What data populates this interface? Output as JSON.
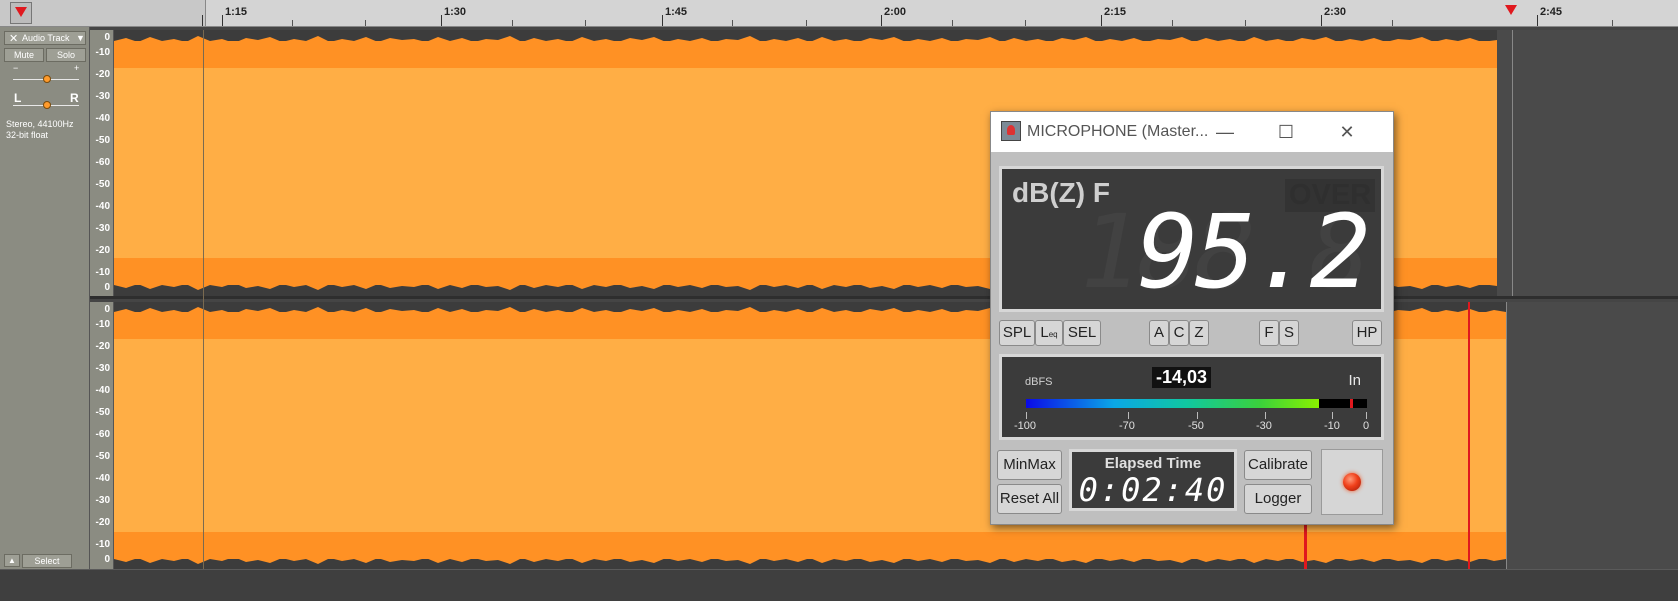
{
  "ruler": {
    "labels": [
      "1:15",
      "1:30",
      "1:45",
      "2:00",
      "2:15",
      "2:30",
      "2:45"
    ]
  },
  "track": {
    "name": "Audio Track",
    "mute": "Mute",
    "solo": "Solo",
    "gain_minus": "−",
    "gain_plus": "+",
    "pan_left": "L",
    "pan_right": "R",
    "info_line1": "Stereo, 44100Hz",
    "info_line2": "32-bit float",
    "select": "Select"
  },
  "db_scale": [
    "0",
    "-10",
    "-20",
    "-30",
    "-40",
    "-50",
    "-60",
    "-50",
    "-40",
    "-30",
    "-20",
    "-10",
    "0"
  ],
  "mic_window": {
    "title": "MICROPHONE (Master...",
    "mode_label": "dB(Z) F",
    "over_label": "OVER",
    "reading": "95.2",
    "buttons_spl": [
      "SPL",
      "L",
      "SEL"
    ],
    "leq_sub": "eq",
    "weighting": [
      "A",
      "C",
      "Z"
    ],
    "time_weighting": [
      "F",
      "S"
    ],
    "hp": "HP",
    "meter": {
      "unit": "dBFS",
      "value": "-14,03",
      "source": "In",
      "level_fraction": 0.86,
      "peak_fraction": 0.95,
      "scale": [
        "-100",
        "-70",
        "-50",
        "-30",
        "-10",
        "0"
      ]
    },
    "minmax": "MinMax",
    "reset": "Reset All",
    "elapsed_label": "Elapsed Time",
    "elapsed_value": "0:02:40",
    "calibrate": "Calibrate",
    "logger": "Logger"
  },
  "colors": {
    "waveform_light": "#ffae45",
    "waveform_mid": "#ff9124",
    "waveform_edge": "#3c3c3c",
    "playhead": "#e0181e"
  }
}
